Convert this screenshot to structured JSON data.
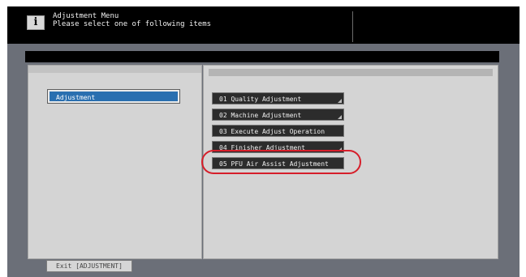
{
  "header": {
    "info_icon": "i",
    "title": "Adjustment Menu",
    "subtitle": "Please select one of following items"
  },
  "left_panel": {
    "items": [
      {
        "label": "Adjustment",
        "selected": true
      }
    ]
  },
  "menu": {
    "items": [
      {
        "label": "01 Quality Adjustment",
        "has_submenu": true
      },
      {
        "label": "02 Machine Adjustment",
        "has_submenu": true
      },
      {
        "label": "03 Execute Adjust Operation",
        "has_submenu": false
      },
      {
        "label": "04 Finisher Adjustment",
        "has_submenu": true
      },
      {
        "label": "05 PFU Air Assist Adjustment",
        "has_submenu": false,
        "highlighted": true
      }
    ]
  },
  "footer": {
    "exit_label": "Exit [ADJUSTMENT]"
  },
  "colors": {
    "selected_item": "#2a6fb0",
    "button_bg": "#2c2c2c",
    "highlight_ring": "#d61e2a"
  }
}
